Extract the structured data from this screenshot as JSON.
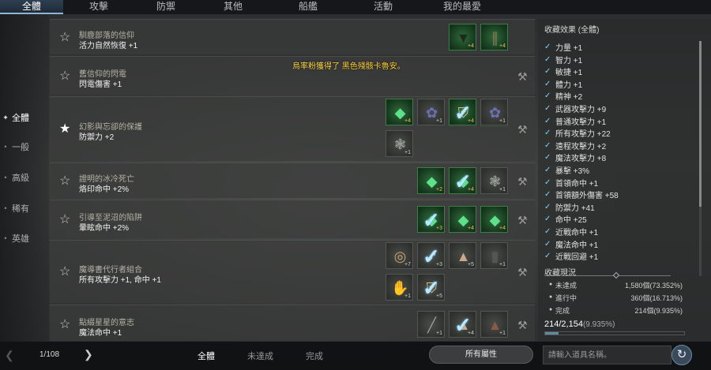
{
  "top_tabs": [
    {
      "label": "全體",
      "active": true
    },
    {
      "label": "攻擊",
      "active": false
    },
    {
      "label": "防禦",
      "active": false
    },
    {
      "label": "其他",
      "active": false
    },
    {
      "label": "船艦",
      "active": false
    },
    {
      "label": "活動",
      "active": false
    },
    {
      "label": "我的最愛",
      "active": false
    }
  ],
  "sidebar": {
    "items": [
      {
        "label": "全體",
        "active": true
      },
      {
        "label": "一般",
        "active": false
      },
      {
        "label": "高級",
        "active": false
      },
      {
        "label": "稀有",
        "active": false
      },
      {
        "label": "英雄",
        "active": false
      }
    ]
  },
  "notification": {
    "prefix": "烏率粉獲得了",
    "item": "黑色殘骸卡魯安。"
  },
  "collections": [
    {
      "name": "馴鹿部落的信仰",
      "effect": "活力自然恢復 +1",
      "favorite": false,
      "has_hammer": false,
      "slots": [
        {
          "style": "green",
          "glyph": "jacket-icon",
          "count": "+4",
          "checked": false
        },
        {
          "style": "green",
          "glyph": "pants-icon",
          "count": "+4",
          "checked": false
        }
      ]
    },
    {
      "name": "舊信仰的閃電",
      "effect": "閃電傷害 +1",
      "favorite": false,
      "has_hammer": true,
      "slots": [
        {
          "style": "gray",
          "glyph": "leggings-icon",
          "count": "+1",
          "checked": false
        },
        {
          "style": "green",
          "glyph": "tunic-icon",
          "count": "+4",
          "checked": true
        }
      ]
    },
    {
      "name": "幻影與忘卻的保護",
      "effect": "防禦力 +2",
      "favorite": true,
      "has_hammer": true,
      "slots": [
        {
          "style": "green",
          "glyph": "emerald-icon",
          "count": "+4",
          "checked": false
        },
        {
          "style": "gray",
          "glyph": "flower-icon",
          "count": "+1",
          "checked": false
        },
        {
          "style": "green",
          "glyph": "armor-icon",
          "count": "+4",
          "checked": true
        },
        {
          "style": "gray",
          "glyph": "flower-icon",
          "count": "+1",
          "checked": false
        },
        {
          "style": "gray",
          "glyph": "dragon-icon",
          "count": "+1",
          "checked": false
        }
      ]
    },
    {
      "name": "證明的冰冷死亡",
      "effect": "烙印命中 +2%",
      "favorite": false,
      "has_hammer": true,
      "slots": [
        {
          "style": "green",
          "glyph": "emerald-icon",
          "count": "+2",
          "checked": false
        },
        {
          "style": "green",
          "glyph": "emerald-icon",
          "count": "+4",
          "checked": true
        },
        {
          "style": "gray",
          "glyph": "dragon-icon",
          "count": "+1",
          "checked": false
        }
      ]
    },
    {
      "name": "引導至泥沼的陷阱",
      "effect": "暈眩命中 +2%",
      "favorite": false,
      "has_hammer": true,
      "slots": [
        {
          "style": "green",
          "glyph": "emerald-icon",
          "count": "+3",
          "checked": true
        },
        {
          "style": "green",
          "glyph": "emerald-icon",
          "count": "+4",
          "checked": false
        },
        {
          "style": "green",
          "glyph": "emerald-icon",
          "count": "+4",
          "checked": false
        }
      ]
    },
    {
      "name": "魔導書代行者組合",
      "effect": "所有攻擊力 +1, 命中 +1",
      "favorite": false,
      "has_hammer": true,
      "slots": [
        {
          "style": "gray",
          "glyph": "necklace-icon",
          "count": "+7",
          "checked": false
        },
        {
          "style": "gray",
          "glyph": "feather-icon",
          "count": "+3",
          "checked": true
        },
        {
          "style": "gray",
          "glyph": "robe-icon",
          "count": "+5",
          "checked": false
        },
        {
          "style": "gray",
          "glyph": "boots-icon",
          "count": "+1",
          "checked": false
        },
        {
          "style": "gray",
          "glyph": "gloves-icon",
          "count": "+1",
          "checked": false
        },
        {
          "style": "gray",
          "glyph": "armor-icon",
          "count": "+5",
          "checked": true
        }
      ]
    },
    {
      "name": "點綴星星的意志",
      "effect": "魔法命中 +1",
      "favorite": false,
      "has_hammer": true,
      "slots": [
        {
          "style": "gray",
          "glyph": "staff-icon",
          "count": "+1",
          "checked": false
        },
        {
          "style": "gray",
          "glyph": "robe-icon",
          "count": "+4",
          "checked": true
        },
        {
          "style": "gray",
          "glyph": "cloak-icon",
          "count": "+1",
          "checked": false
        }
      ]
    }
  ],
  "right_panel": {
    "effects_title": "收藏效果 (全體)",
    "effects": [
      "力量 +1",
      "智力 +1",
      "敏捷 +1",
      "體力 +1",
      "精神 +2",
      "武器攻擊力 +9",
      "普通攻擊力 +1",
      "所有攻擊力 +22",
      "遠程攻擊力 +2",
      "魔法攻擊力 +8",
      "暴擊 +3%",
      "首領命中 +1",
      "首領額外傷害 +58",
      "防禦力 +41",
      "命中 +25",
      "近戰命中 +1",
      "魔法命中 +1",
      "近戰回避 +1"
    ],
    "status_title": "收藏現況",
    "status": [
      {
        "label": "未達成",
        "value": "1,580個(73.352%)"
      },
      {
        "label": "進行中",
        "value": "360個(16.713%)"
      },
      {
        "label": "完成",
        "value": "214個(9.935%)"
      }
    ],
    "progress_count": "214/2,154",
    "progress_pct": "(9.935%)",
    "progress_fraction": 0.09935
  },
  "bottom": {
    "page": "1/108",
    "tabs": [
      {
        "label": "全體",
        "active": true
      },
      {
        "label": "未達成",
        "active": false
      },
      {
        "label": "完成",
        "active": false
      }
    ],
    "attr_button": "所有屬性",
    "search_placeholder": "請輸入道具名稱。"
  }
}
